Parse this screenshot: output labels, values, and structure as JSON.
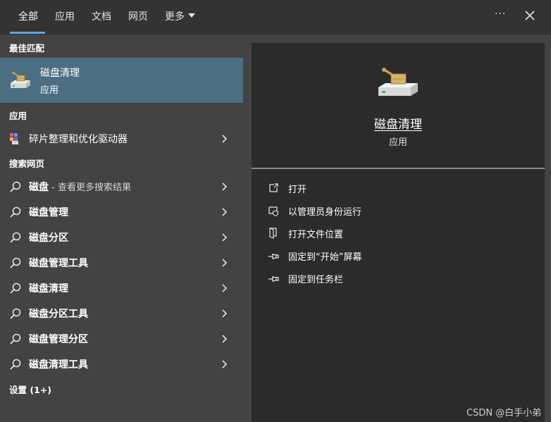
{
  "tabs": [
    {
      "label": "全部"
    },
    {
      "label": "应用"
    },
    {
      "label": "文档"
    },
    {
      "label": "网页"
    },
    {
      "label": "更多"
    }
  ],
  "header": {
    "more_options_icon": "ellipsis-icon",
    "close_icon": "close-icon"
  },
  "colors": {
    "accent": "#5aa6e6",
    "selected_bg": "#4b6e82",
    "panel_bg": "#2b2b2b",
    "page_bg": "#434343",
    "tabbar_bg": "#333333"
  },
  "left": {
    "best_match_header": "最佳匹配",
    "best_match": {
      "title": "磁盘清理",
      "subtitle": "应用",
      "icon": "disk-cleanup-icon"
    },
    "apps_header": "应用",
    "apps": [
      {
        "label": "碎片整理和优化驱动器",
        "icon": "defrag-icon"
      }
    ],
    "web_header": "搜索网页",
    "web_results": [
      {
        "label": "磁盘",
        "sub": " - 查看更多搜索结果"
      },
      {
        "label": "磁盘管理",
        "sub": ""
      },
      {
        "label": "磁盘分区",
        "sub": ""
      },
      {
        "label": "磁盘管理工具",
        "sub": ""
      },
      {
        "label": "磁盘清理",
        "sub": ""
      },
      {
        "label": "磁盘分区工具",
        "sub": ""
      },
      {
        "label": "磁盘管理分区",
        "sub": ""
      },
      {
        "label": "磁盘清理工具",
        "sub": ""
      }
    ],
    "settings_header": "设置 (1+)"
  },
  "right": {
    "title": "磁盘清理",
    "subtitle": "应用",
    "actions": [
      {
        "label": "打开",
        "icon": "open-icon"
      },
      {
        "label": "以管理员身份运行",
        "icon": "shield-icon"
      },
      {
        "label": "打开文件位置",
        "icon": "file-location-icon"
      },
      {
        "label": "固定到“开始”屏幕",
        "icon": "pin-icon"
      },
      {
        "label": "固定到任务栏",
        "icon": "pin-icon"
      }
    ]
  },
  "watermark": "CSDN @白手小弟"
}
